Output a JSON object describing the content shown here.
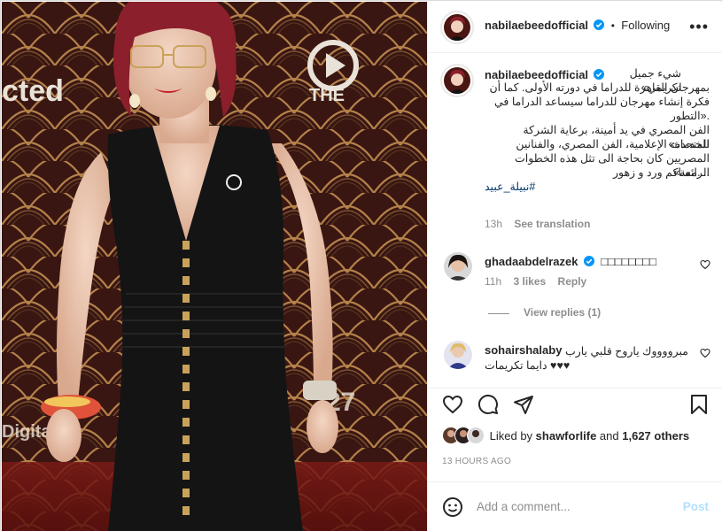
{
  "post": {
    "author": "nabilaebeedofficial",
    "follow_status": "Following",
    "more_icon": "more-horizontal-icon",
    "photo_logos": {
      "left_text": "cted",
      "center_text": "THE",
      "bottom_left": "Digital",
      "bottom_right": "27"
    }
  },
  "caption": {
    "author": "nabilaebeedofficial",
    "lines": [
      "شيء جميل تكريمي»",
      "بمهرجان القاهرة للدراما في دورته الأولى. كما أن",
      "فكرة إنشاء مهرجان للدراما سيساعد الدراما في",
      ".«التطور",
      "الفن المصري في يد أمينة، برعاية الشركة المتحدة»",
      "للخدمات الإعلامية، الفن المصري، والفنانين",
      "المصريين كان بحاجة الى تثل هذه الخطوات الرائعة»",
      "....مساكم ورد و زهور"
    ],
    "hashtag": "#نبيلة_عبيد",
    "time": "13h",
    "see_translation": "See translation"
  },
  "comments": [
    {
      "user": "ghadaabdelrazek",
      "verified": true,
      "text": "□□□□□□□□",
      "time": "11h",
      "likes": "3 likes",
      "reply": "Reply",
      "view_replies": "View replies (1)"
    },
    {
      "user": "sohairshalaby",
      "verified": false,
      "text_line1": "مبرووووك ياروح قلبي يارب",
      "text_line2": "♥♥♥ دايما تكريمات"
    }
  ],
  "actions": {
    "like_icon": "heart-icon",
    "comment_icon": "comment-icon",
    "share_icon": "share-icon",
    "save_icon": "bookmark-icon"
  },
  "likes": {
    "prefix": "Liked by",
    "user": "shawforlife",
    "connector": "and",
    "others": "1,627 others"
  },
  "timestamp": "13 HOURS AGO",
  "add_comment": {
    "emoji_icon": "emoji-icon",
    "placeholder": "Add a comment...",
    "post_label": "Post"
  },
  "colors": {
    "verified_blue": "#0095f6",
    "link_blue": "#00376b",
    "post_disabled": "#b2dffc",
    "secondary_text": "#8e8e8e"
  }
}
